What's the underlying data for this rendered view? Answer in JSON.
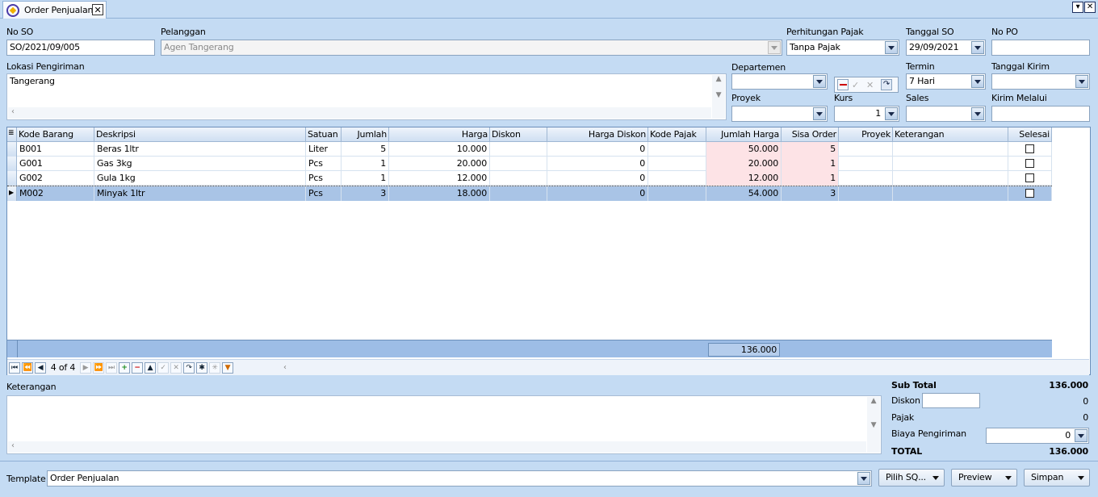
{
  "window": {
    "tab_title": "Order Penjualan",
    "close_glyph": "✕",
    "min_glyph": "▾",
    "x_glyph": "✕"
  },
  "form": {
    "no_so_label": "No SO",
    "no_so": "SO/2021/09/005",
    "pelanggan_label": "Pelanggan",
    "pelanggan": "Agen Tangerang",
    "pajak_label": "Perhitungan Pajak",
    "pajak": "Tanpa Pajak",
    "tanggal_so_label": "Tanggal SO",
    "tanggal_so": "29/09/2021",
    "no_po_label": "No PO",
    "no_po": "",
    "lokasi_label": "Lokasi Pengiriman",
    "lokasi": "Tangerang",
    "departemen_label": "Departemen",
    "departemen": "",
    "termin_label": "Termin",
    "termin": "7 Hari",
    "tanggal_kirim_label": "Tanggal Kirim",
    "tanggal_kirim": "",
    "proyek_label": "Proyek",
    "proyek": "",
    "kurs_label": "Kurs",
    "kurs": "1",
    "sales_label": "Sales",
    "sales": "",
    "kirim_melalui_label": "Kirim Melalui",
    "kirim_melalui": ""
  },
  "grid": {
    "columns": [
      "Kode Barang",
      "Deskripsi",
      "Satuan",
      "Jumlah",
      "Harga",
      "Diskon",
      "Harga Diskon",
      "Kode Pajak",
      "Jumlah Harga",
      "Sisa Order",
      "Proyek",
      "Keterangan",
      "Selesai"
    ],
    "rows": [
      {
        "kode": "B001",
        "desk": "Beras 1ltr",
        "satuan": "Liter",
        "jumlah": "5",
        "harga": "10.000",
        "diskon": "",
        "harga_diskon": "0",
        "kode_pajak": "",
        "jumlah_harga": "50.000",
        "sisa": "5",
        "proyek": "",
        "ket": ""
      },
      {
        "kode": "G001",
        "desk": "Gas 3kg",
        "satuan": "Pcs",
        "jumlah": "1",
        "harga": "20.000",
        "diskon": "",
        "harga_diskon": "0",
        "kode_pajak": "",
        "jumlah_harga": "20.000",
        "sisa": "1",
        "proyek": "",
        "ket": ""
      },
      {
        "kode": "G002",
        "desk": "Gula 1kg",
        "satuan": "Pcs",
        "jumlah": "1",
        "harga": "12.000",
        "diskon": "",
        "harga_diskon": "0",
        "kode_pajak": "",
        "jumlah_harga": "12.000",
        "sisa": "1",
        "proyek": "",
        "ket": ""
      },
      {
        "kode": "M002",
        "desk": "Minyak 1ltr",
        "satuan": "Pcs",
        "jumlah": "3",
        "harga": "18.000",
        "diskon": "",
        "harga_diskon": "0",
        "kode_pajak": "",
        "jumlah_harga": "54.000",
        "sisa": "3",
        "proyek": "",
        "ket": ""
      }
    ],
    "footer_total": "136.000",
    "record_position": "4 of 4",
    "selected_row": 3
  },
  "keterangan_label": "Keterangan",
  "keterangan": "",
  "totals": {
    "sub_total_label": "Sub Total",
    "sub_total": "136.000",
    "diskon_label": "Diskon",
    "diskon_input": "",
    "diskon": "0",
    "pajak_label": "Pajak",
    "pajak": "0",
    "biaya_label": "Biaya Pengiriman",
    "biaya": "0",
    "total_label": "TOTAL",
    "total": "136.000"
  },
  "bottom": {
    "template_label": "Template",
    "template": "Order Penjualan",
    "pilih_sq_label": "Pilih SQ...",
    "preview_label": "Preview",
    "simpan_label": "Simpan"
  },
  "colors": {
    "background": "#c4dbf3",
    "selected_row": "#a9c4e6",
    "amount_pink": "#fde3e6"
  }
}
